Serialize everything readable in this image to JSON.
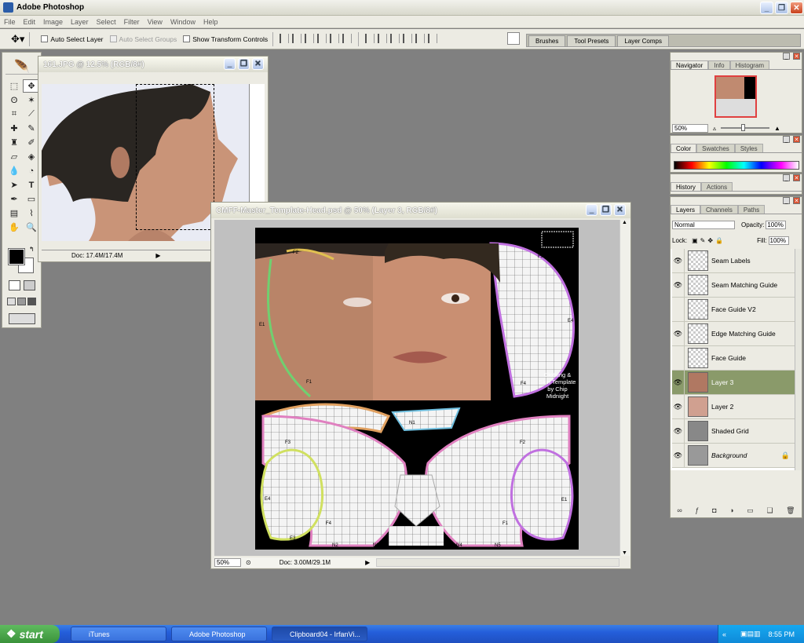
{
  "app": {
    "title": "Adobe Photoshop"
  },
  "menu": [
    "File",
    "Edit",
    "Image",
    "Layer",
    "Select",
    "Filter",
    "View",
    "Window",
    "Help"
  ],
  "options": {
    "auto_select_layer": "Auto Select Layer",
    "auto_select_groups": "Auto Select Groups",
    "show_transform": "Show Transform Controls",
    "well_tabs": [
      "Brushes",
      "Tool Presets",
      "Layer Comps"
    ]
  },
  "doc1": {
    "title": "161.JPG @ 12.5% (RGB/8#)",
    "status": "Doc: 17.4M/17.4M"
  },
  "doc2": {
    "title": "CMFF-Master_Template-Head.psd @ 50% (Layer 3, RGB/8#)",
    "zoom": "50%",
    "status": "Doc: 3.00M/29.1M"
  },
  "canvas_text": {
    "credit": "Clothing & Skin Template by Chip Midnight"
  },
  "navigator": {
    "tabs": [
      "Navigator",
      "Info",
      "Histogram"
    ],
    "zoom": "50%"
  },
  "color_panel": {
    "tabs": [
      "Color",
      "Swatches",
      "Styles"
    ]
  },
  "history_panel": {
    "tabs": [
      "History",
      "Actions"
    ]
  },
  "layers_panel": {
    "tabs": [
      "Layers",
      "Channels",
      "Paths"
    ],
    "blend_mode": "Normal",
    "opacity_label": "Opacity:",
    "opacity": "100%",
    "lock_label": "Lock:",
    "fill_label": "Fill:",
    "fill": "100%",
    "layers": [
      {
        "name": "Seam Labels",
        "visible": true
      },
      {
        "name": "Seam Matching Guide",
        "visible": true
      },
      {
        "name": "Face Guide V2",
        "visible": false
      },
      {
        "name": "Edge Matching Guide",
        "visible": true
      },
      {
        "name": "Face Guide",
        "visible": false
      },
      {
        "name": "Layer 3",
        "visible": true,
        "selected": true
      },
      {
        "name": "Layer 2",
        "visible": true
      },
      {
        "name": "Shaded Grid",
        "visible": true
      },
      {
        "name": "Background",
        "visible": true
      }
    ]
  },
  "taskbar": {
    "start": "start",
    "buttons": [
      "iTunes",
      "Adobe Photoshop",
      "Clipboard04 - IrfanVi..."
    ],
    "clock": "8:55 PM"
  }
}
